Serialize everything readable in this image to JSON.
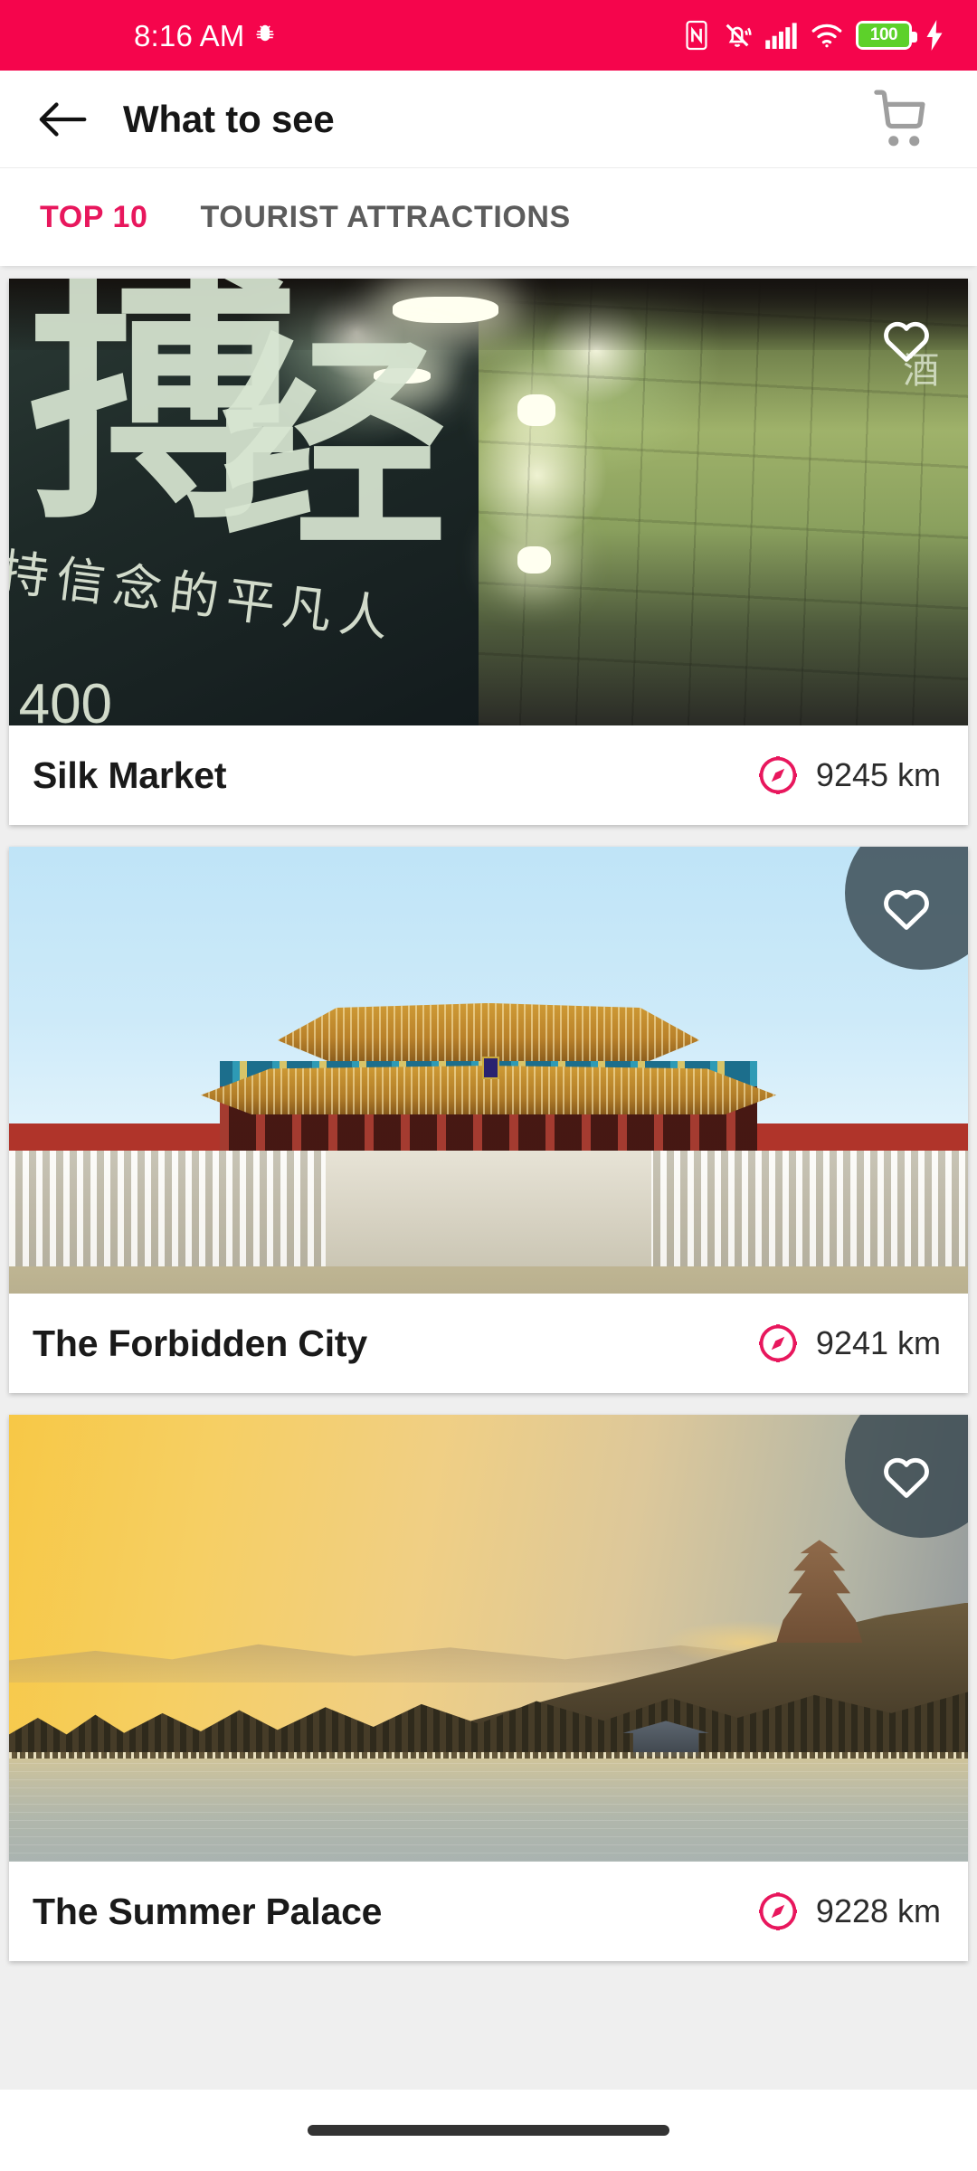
{
  "status_bar": {
    "time": "8:16 AM",
    "background_color": "#F5054C",
    "icons": [
      "bug-icon",
      "nfc-icon",
      "mute-vibrate-icon",
      "cellular-signal-icon",
      "wifi-icon"
    ],
    "battery": {
      "level_text": "100",
      "fill_color": "#5DD12A",
      "charging": true
    }
  },
  "app_bar": {
    "back_label": "back-arrow",
    "title": "What to see",
    "cart_label": "shopping-cart"
  },
  "tabs": [
    {
      "label": "TOP 10",
      "active": true,
      "color": "#E8175D"
    },
    {
      "label": "TOURIST ATTRACTIONS",
      "active": false,
      "color": "#5C5C5C"
    }
  ],
  "accent_color": "#E8175D",
  "list_background": "#EFEFEF",
  "cards": [
    {
      "title": "Silk Market",
      "distance": "9245 km",
      "favorite": false,
      "fav_scrim": false,
      "photo": "silk-market-night-signage"
    },
    {
      "title": "The Forbidden City",
      "distance": "9241 km",
      "favorite": false,
      "fav_scrim": true,
      "photo": "forbidden-city-hall-of-supreme-harmony"
    },
    {
      "title": "The Summer Palace",
      "distance": "9228 km",
      "favorite": false,
      "fav_scrim": true,
      "photo": "summer-palace-sunset-lake"
    }
  ],
  "silk_photo_text": {
    "big_1": "搏",
    "big_2": "经",
    "line_small": "持信念的平凡人",
    "price": "400",
    "logo_text": "酒"
  },
  "nav_bar": {
    "gesture_pill": "home-gesture-pill"
  }
}
